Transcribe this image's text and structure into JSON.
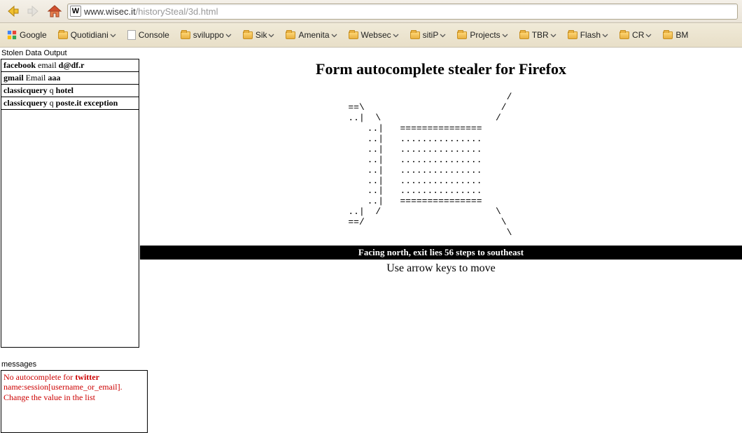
{
  "url": {
    "domain": "www.wisec.it",
    "path": "/historySteal/3d.html"
  },
  "bookmarks": [
    {
      "label": "Google",
      "type": "google",
      "dropdown": false
    },
    {
      "label": "Quotidiani",
      "type": "folder",
      "dropdown": true
    },
    {
      "label": "Console",
      "type": "page",
      "dropdown": false
    },
    {
      "label": "sviluppo",
      "type": "folder",
      "dropdown": true
    },
    {
      "label": "Sik",
      "type": "folder",
      "dropdown": true
    },
    {
      "label": "Amenita",
      "type": "folder",
      "dropdown": true
    },
    {
      "label": "Websec",
      "type": "folder",
      "dropdown": true
    },
    {
      "label": "sitiP",
      "type": "folder",
      "dropdown": true
    },
    {
      "label": "Projects",
      "type": "folder",
      "dropdown": true
    },
    {
      "label": "TBR",
      "type": "folder",
      "dropdown": true
    },
    {
      "label": "Flash",
      "type": "folder",
      "dropdown": true
    },
    {
      "label": "CR",
      "type": "folder",
      "dropdown": true
    },
    {
      "label": "BM",
      "type": "folder",
      "dropdown": false
    }
  ],
  "stolen": {
    "heading": "Stolen Data Output",
    "rows": [
      {
        "site": "facebook",
        "field": "email",
        "value": "d@df.r",
        "extra": ""
      },
      {
        "site": "gmail",
        "field": "Email",
        "value": "aaa",
        "extra": ""
      },
      {
        "site": "classicquery",
        "field": "q",
        "value": "hotel",
        "extra": ""
      },
      {
        "site": "classicquery",
        "field": "q",
        "value": "poste.it",
        "extra": "exception"
      }
    ]
  },
  "messages": {
    "heading": "messages",
    "line1a": "No autocomplete for ",
    "line1b": "twitter",
    "line2": "name:session[username_or_email].",
    "line3": "Change the value in the list"
  },
  "page": {
    "title": "Form autocomplete stealer for Firefox",
    "ascii": "                             /    \n==\\                         /     \n..|  \\                     /      \n..|   ===============      \n..|   ...............      \n..|   ...............      \n..|   ...............      \n..|   ...............      \n..|   ...............      \n..|   ...............      \n..|   ===============      \n..|  /                     \\      \n==/                         \\     \n                             \\    ",
    "status": "Facing north, exit lies 56 steps to southeast",
    "instructions": "Use arrow keys to move"
  }
}
